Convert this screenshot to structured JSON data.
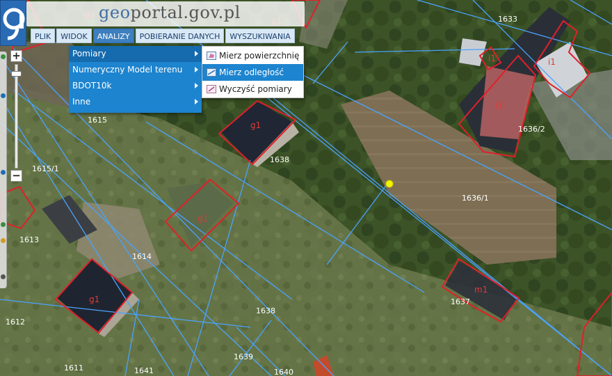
{
  "header": {
    "site_title_geo": "geo",
    "site_title_rest": "portal.gov.pl"
  },
  "menubar": {
    "items": [
      {
        "label": "PLIK"
      },
      {
        "label": "WIDOK"
      },
      {
        "label": "ANALIZY",
        "active": true
      },
      {
        "label": "POBIERANIE DANYCH"
      },
      {
        "label": "WYSZUKIWANIA"
      }
    ]
  },
  "dropdown": {
    "items": [
      {
        "label": "Pomiary",
        "highlighted": true
      },
      {
        "label": "Numeryczny Model terenu"
      },
      {
        "label": "BDOT10k"
      },
      {
        "label": "Inne"
      }
    ]
  },
  "submenu": {
    "items": [
      {
        "label": "Mierz powierzchnię",
        "icon": "area-measure-icon"
      },
      {
        "label": "Mierz odległość",
        "icon": "distance-measure-icon",
        "highlighted": true
      },
      {
        "label": "Wyczyść pomiary",
        "icon": "clear-measure-icon"
      }
    ]
  },
  "zoom": {
    "plus": "+",
    "minus": "−"
  },
  "map": {
    "parcel_labels": [
      "1633",
      "1636/2",
      "1615",
      "1638",
      "1615/1",
      "1636/1",
      "1613",
      "1614",
      "1637",
      "1612",
      "1638",
      "1611",
      "1641",
      "1639",
      "1640"
    ],
    "building_labels": [
      "i1",
      "i1",
      "i1",
      "g1",
      "g1",
      "g1",
      "m1",
      "g1",
      "g1"
    ],
    "parcel_line_color": "#4aa3ff",
    "building_outline_color": "#e0202a",
    "measure_point_color": "#f4f400"
  }
}
